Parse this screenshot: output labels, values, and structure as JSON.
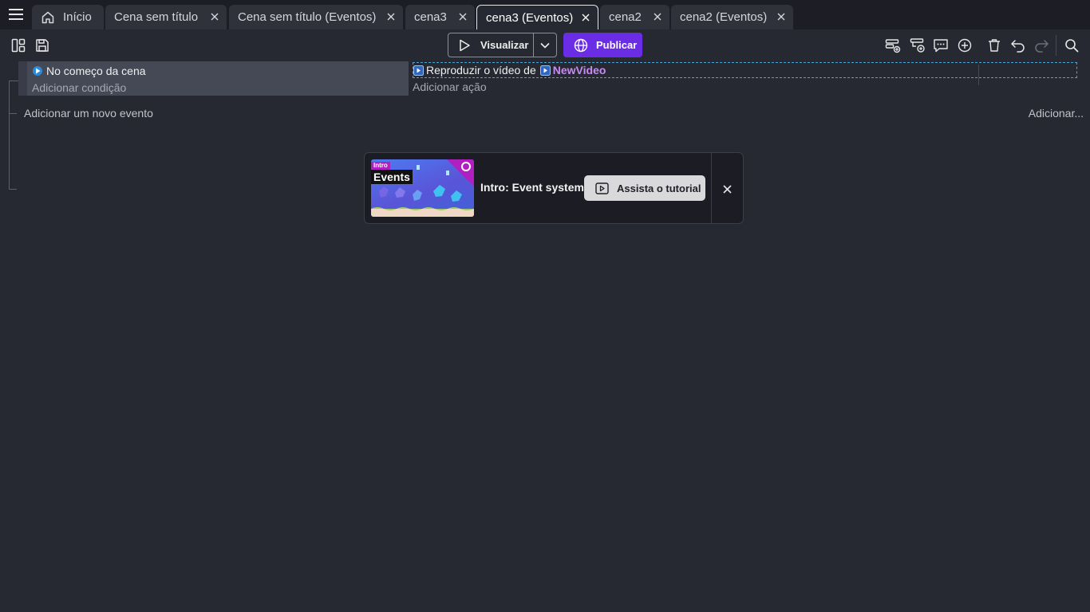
{
  "tabs": [
    {
      "label": "Início"
    },
    {
      "label": "Cena sem título"
    },
    {
      "label": "Cena sem título (Eventos)"
    },
    {
      "label": "cena3"
    },
    {
      "label": "cena3 (Eventos)"
    },
    {
      "label": "cena2"
    },
    {
      "label": "cena2 (Eventos)"
    }
  ],
  "toolbar": {
    "preview_label": "Visualizar",
    "publish_label": "Publicar"
  },
  "event": {
    "condition_text": "No começo da cena",
    "add_condition": "Adicionar condição",
    "action_text": "Reproduzir o vídeo de",
    "action_object": "NewVideo",
    "add_action": "Adicionar ação"
  },
  "sheet": {
    "add_event": "Adicionar um novo evento",
    "add_more": "Adicionar..."
  },
  "tutorial": {
    "thumb_tag": "Intro",
    "thumb_title": "Events",
    "title": "Intro: Event system",
    "button_label": "Assista o tutorial"
  },
  "colors": {
    "background": "#262932",
    "tabbar": "#1d1e25",
    "publish": "#6b2ce6",
    "object_name": "#c78cf0",
    "selection_border": "#4aa6d9"
  }
}
